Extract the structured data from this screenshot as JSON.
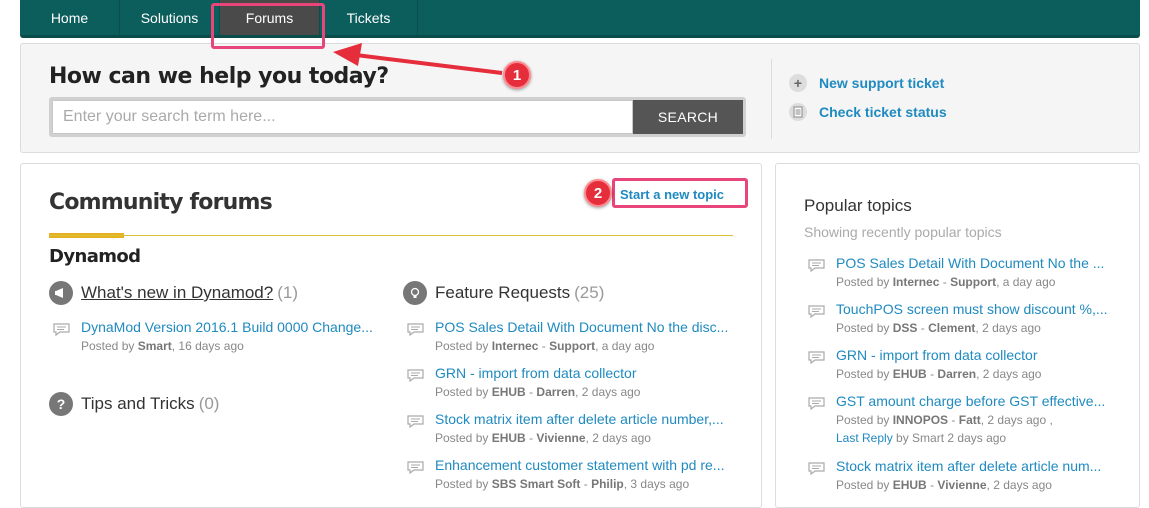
{
  "nav": {
    "tabs": [
      {
        "label": "Home"
      },
      {
        "label": "Solutions"
      },
      {
        "label": "Forums"
      },
      {
        "label": "Tickets"
      }
    ]
  },
  "annotations": {
    "badge1": "1",
    "badge2": "2"
  },
  "search": {
    "title": "How can we help you today?",
    "placeholder": "Enter your search term here...",
    "button": "SEARCH"
  },
  "side_links": {
    "new_ticket": "New support ticket",
    "check_status": "Check ticket status"
  },
  "forums": {
    "title": "Community forums",
    "new_topic": "Start a new topic",
    "category": "Dynamod",
    "whats_new": {
      "name": "What's new in Dynamod?",
      "count": "(1)",
      "topics": [
        {
          "title": "DynaMod Version 2016.1 Build 0000 Change...",
          "prefix": "Posted by",
          "author": "Smart",
          "time": ", 16 days ago"
        }
      ]
    },
    "tips": {
      "name": "Tips and Tricks",
      "count": "(0)"
    },
    "features": {
      "name": "Feature Requests",
      "count": "(25)",
      "topics": [
        {
          "title": "POS Sales Detail With Document No the disc...",
          "prefix": "Posted by",
          "author": "Internec",
          "sep": " - ",
          "author2": "Support",
          "time": ", a day ago"
        },
        {
          "title": "GRN - import from data collector",
          "prefix": "Posted by",
          "author": "EHUB",
          "sep": " - ",
          "author2": "Darren",
          "time": ", 2 days ago"
        },
        {
          "title": "Stock matrix item after delete article number,...",
          "prefix": "Posted by",
          "author": "EHUB",
          "sep": " - ",
          "author2": "Vivienne",
          "time": ", 2 days ago"
        },
        {
          "title": "Enhancement customer statement with pd re...",
          "prefix": "Posted by",
          "author": "SBS Smart Soft",
          "sep": " - ",
          "author2": "Philip",
          "time": ", 3 days ago"
        }
      ]
    }
  },
  "popular": {
    "title": "Popular topics",
    "subtitle": "Showing recently popular topics",
    "topics": [
      {
        "title": "POS Sales Detail With Document No the ...",
        "prefix": "Posted by",
        "author": "Internec",
        "sep": " - ",
        "author2": "Support",
        "time": ", a day ago"
      },
      {
        "title": "TouchPOS screen must show discount %,...",
        "prefix": "Posted by",
        "author": "DSS",
        "sep": " - ",
        "author2": "Clement",
        "time": ", 2 days ago"
      },
      {
        "title": "GRN - import from data collector",
        "prefix": "Posted by",
        "author": "EHUB",
        "sep": " - ",
        "author2": "Darren",
        "time": ", 2 days ago"
      },
      {
        "title": "GST amount charge before GST effective...",
        "prefix": "Posted by",
        "author": "INNOPOS",
        "sep": " - ",
        "author2": "Fatt",
        "time": ", 2 days ago ,",
        "last_reply": "Last Reply",
        "last_reply_rest": " by Smart 2 days ago"
      },
      {
        "title": "Stock matrix item after delete article num...",
        "prefix": "Posted by",
        "author": "EHUB",
        "sep": " - ",
        "author2": "Vivienne",
        "time": ", 2 days ago"
      }
    ]
  },
  "colors": {
    "nav_bg": "#0b5e5c",
    "active_tab": "#4a4a4a",
    "link": "#1f8ac0",
    "highlight": "#e8457a",
    "badge": "#e52d3b",
    "accent": "#e6b020"
  },
  "icons": {
    "new_ticket": "plus-circle-icon",
    "check_status": "document-icon",
    "whats_new": "megaphone-icon",
    "features": "lightbulb-icon",
    "tips": "question-icon",
    "topic": "speech-bubble-icon"
  }
}
